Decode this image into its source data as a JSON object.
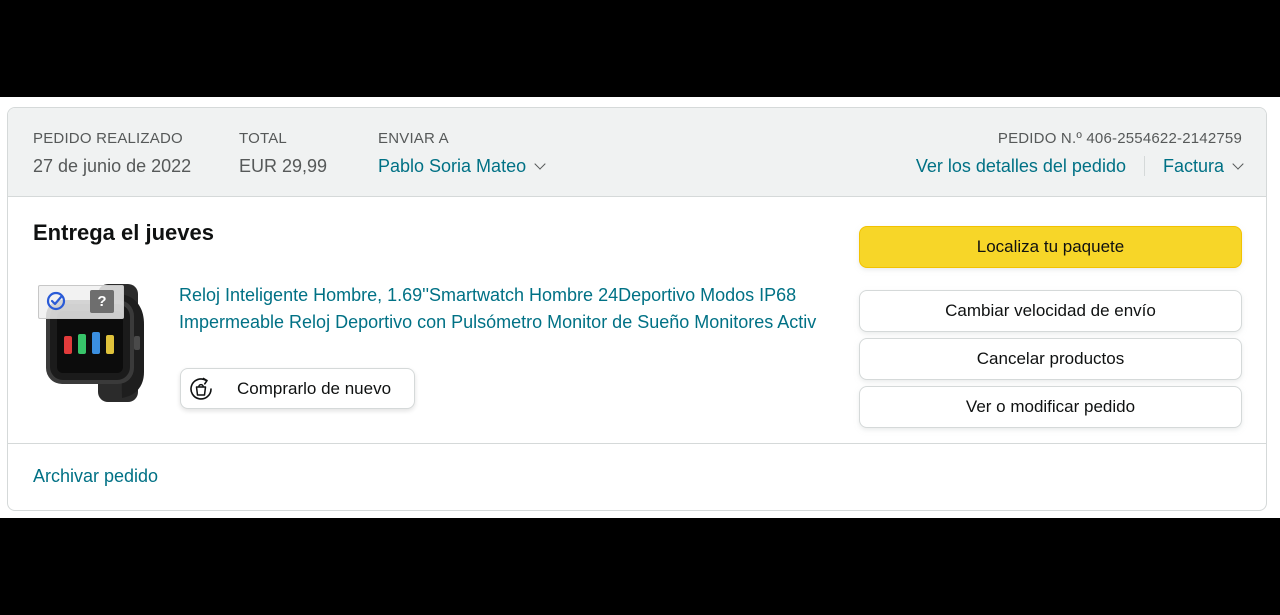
{
  "order_header": {
    "placed_label": "PEDIDO REALIZADO",
    "placed_value": "27 de junio de 2022",
    "total_label": "TOTAL",
    "total_value": "EUR 29,99",
    "ship_label": "ENVIAR A",
    "ship_value": "Pablo Soria Mateo",
    "order_number": "PEDIDO N.º 406-2554622-2142759",
    "details_link": "Ver los detalles del pedido",
    "invoice_link": "Factura"
  },
  "shipment": {
    "status_title": "Entrega el jueves",
    "product_title": "Reloj Inteligente Hombre, 1.69''Smartwatch Hombre 24Deportivo Modos IP68 Impermeable Reloj Deportivo con Pulsómetro Monitor de Sueño Monitores Activ",
    "buy_again_label": "Comprarlo de nuevo",
    "overlay_question": "?"
  },
  "actions": {
    "track_label": "Localiza tu paquete",
    "change_speed_label": "Cambiar velocidad de envío",
    "cancel_label": "Cancelar productos",
    "modify_label": "Ver o modificar pedido"
  },
  "footer": {
    "archive_label": "Archivar pedido"
  },
  "colors": {
    "link": "#007185",
    "primary_button": "#f7d628",
    "header_bg": "#f0f2f2",
    "text": "#0f1111",
    "muted_text": "#565959"
  },
  "icons": {
    "product_image": "smartwatch-product-image",
    "overlay_check": "check-circle-icon",
    "overlay_help": "question-mark-icon",
    "buy_again": "buy-again-cycle-icon",
    "dropdown": "chevron-down-icon"
  }
}
